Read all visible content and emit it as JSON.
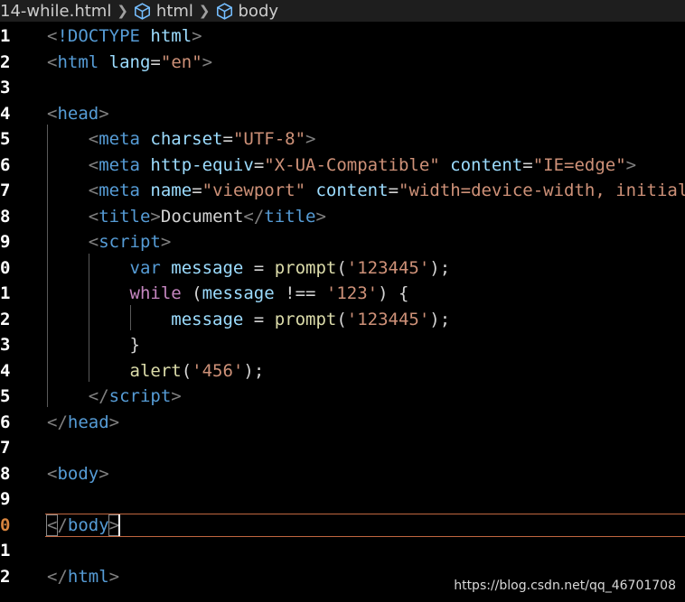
{
  "breadcrumb": {
    "file": "14-while.html",
    "items": [
      "html",
      "body"
    ],
    "icon": "cube-icon"
  },
  "editor": {
    "active_line_index": 19,
    "lines": [
      {
        "num": "1",
        "tokens": [
          [
            "punct",
            "<"
          ],
          [
            "decl",
            "!DOCTYPE "
          ],
          [
            "attr",
            "html"
          ],
          [
            "punct",
            ">"
          ]
        ]
      },
      {
        "num": "2",
        "tokens": [
          [
            "punct",
            "<"
          ],
          [
            "tag",
            "html "
          ],
          [
            "attr",
            "lang"
          ],
          [
            "text",
            "="
          ],
          [
            "str",
            "\"en\""
          ],
          [
            "punct",
            ">"
          ]
        ]
      },
      {
        "num": "3",
        "tokens": []
      },
      {
        "num": "4",
        "tokens": [
          [
            "punct",
            "<"
          ],
          [
            "tag",
            "head"
          ],
          [
            "punct",
            ">"
          ]
        ]
      },
      {
        "num": "5",
        "tokens": [
          [
            "text",
            "    "
          ],
          [
            "punct",
            "<"
          ],
          [
            "tag",
            "meta "
          ],
          [
            "attr",
            "charset"
          ],
          [
            "text",
            "="
          ],
          [
            "str",
            "\"UTF-8\""
          ],
          [
            "punct",
            ">"
          ]
        ]
      },
      {
        "num": "6",
        "tokens": [
          [
            "text",
            "    "
          ],
          [
            "punct",
            "<"
          ],
          [
            "tag",
            "meta "
          ],
          [
            "attr",
            "http-equiv"
          ],
          [
            "text",
            "="
          ],
          [
            "str",
            "\"X-UA-Compatible\" "
          ],
          [
            "attr",
            "content"
          ],
          [
            "text",
            "="
          ],
          [
            "str",
            "\"IE=edge\""
          ],
          [
            "punct",
            ">"
          ]
        ]
      },
      {
        "num": "7",
        "tokens": [
          [
            "text",
            "    "
          ],
          [
            "punct",
            "<"
          ],
          [
            "tag",
            "meta "
          ],
          [
            "attr",
            "name"
          ],
          [
            "text",
            "="
          ],
          [
            "str",
            "\"viewport\" "
          ],
          [
            "attr",
            "content"
          ],
          [
            "text",
            "="
          ],
          [
            "str",
            "\"width=device-width, initial"
          ]
        ]
      },
      {
        "num": "8",
        "tokens": [
          [
            "text",
            "    "
          ],
          [
            "punct",
            "<"
          ],
          [
            "tag",
            "title"
          ],
          [
            "punct",
            ">"
          ],
          [
            "text",
            "Document"
          ],
          [
            "punct",
            "</"
          ],
          [
            "tag",
            "title"
          ],
          [
            "punct",
            ">"
          ]
        ]
      },
      {
        "num": "9",
        "tokens": [
          [
            "text",
            "    "
          ],
          [
            "punct",
            "<"
          ],
          [
            "tag",
            "script"
          ],
          [
            "punct",
            ">"
          ]
        ]
      },
      {
        "num": "0",
        "tokens": [
          [
            "text",
            "        "
          ],
          [
            "decl",
            "var "
          ],
          [
            "var",
            "message "
          ],
          [
            "text",
            "= "
          ],
          [
            "fn",
            "prompt"
          ],
          [
            "text",
            "("
          ],
          [
            "str",
            "'123445'"
          ],
          [
            "text",
            ");"
          ]
        ]
      },
      {
        "num": "1",
        "tokens": [
          [
            "text",
            "        "
          ],
          [
            "kw",
            "while "
          ],
          [
            "text",
            "("
          ],
          [
            "var",
            "message "
          ],
          [
            "text",
            "!== "
          ],
          [
            "str",
            "'123'"
          ],
          [
            "text",
            ") {"
          ]
        ]
      },
      {
        "num": "2",
        "tokens": [
          [
            "text",
            "            "
          ],
          [
            "var",
            "message "
          ],
          [
            "text",
            "= "
          ],
          [
            "fn",
            "prompt"
          ],
          [
            "text",
            "("
          ],
          [
            "str",
            "'123445'"
          ],
          [
            "text",
            ");"
          ]
        ]
      },
      {
        "num": "3",
        "tokens": [
          [
            "text",
            "        }"
          ]
        ]
      },
      {
        "num": "4",
        "tokens": [
          [
            "text",
            "        "
          ],
          [
            "fn",
            "alert"
          ],
          [
            "text",
            "("
          ],
          [
            "str",
            "'456'"
          ],
          [
            "text",
            ");"
          ]
        ]
      },
      {
        "num": "5",
        "tokens": [
          [
            "text",
            "    "
          ],
          [
            "punct",
            "</"
          ],
          [
            "tag",
            "script"
          ],
          [
            "punct",
            ">"
          ]
        ]
      },
      {
        "num": "6",
        "tokens": [
          [
            "punct",
            "</"
          ],
          [
            "tag",
            "head"
          ],
          [
            "punct",
            ">"
          ]
        ]
      },
      {
        "num": "7",
        "tokens": []
      },
      {
        "num": "8",
        "tokens": [
          [
            "punct",
            "<"
          ],
          [
            "tag",
            "body"
          ],
          [
            "punct",
            ">"
          ]
        ]
      },
      {
        "num": "9",
        "tokens": []
      },
      {
        "num": "0",
        "tokens": [
          [
            "punct",
            "</"
          ],
          [
            "tag",
            "body"
          ],
          [
            "punct",
            ">"
          ]
        ]
      },
      {
        "num": "1",
        "tokens": []
      },
      {
        "num": "2",
        "tokens": [
          [
            "punct",
            "</"
          ],
          [
            "tag",
            "html"
          ],
          [
            "punct",
            ">"
          ]
        ]
      }
    ]
  },
  "watermark": "https://blog.csdn.net/qq_46701708",
  "colors": {
    "background": "#000000",
    "tag": "#569cd6",
    "attribute": "#9cdcfe",
    "string": "#ce9178",
    "keyword": "#c586c0",
    "function": "#dcdcaa",
    "active_line_number": "#d7843e"
  }
}
